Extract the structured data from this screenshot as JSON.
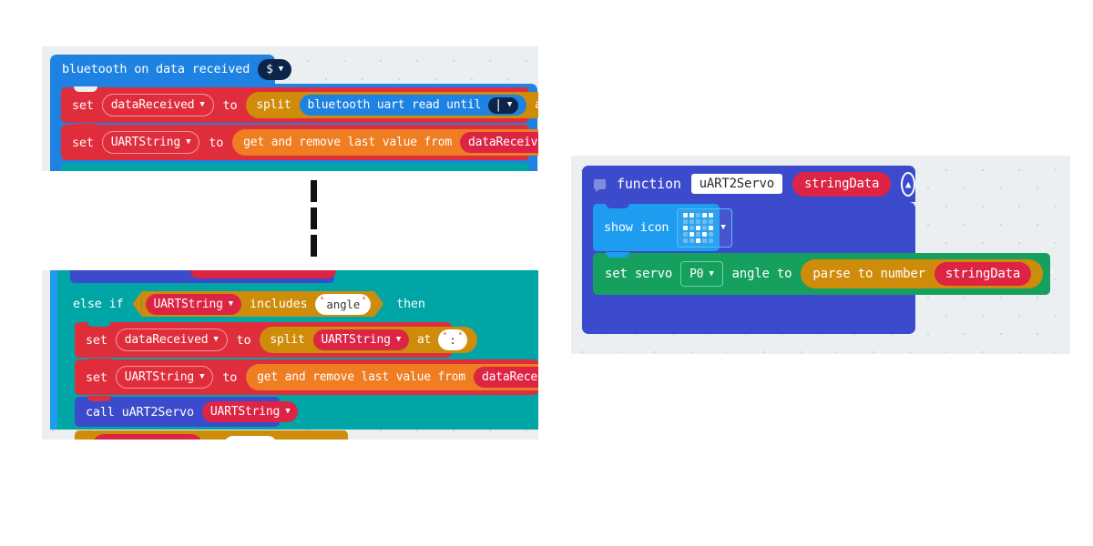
{
  "editor": {
    "name": "makecode-blocks-editor",
    "accent_blue": "#1d82e2",
    "accent_red": "#e02d3c",
    "accent_gold": "#cf8c0b",
    "accent_teal": "#00a5a5",
    "accent_green": "#16a05e",
    "accent_purple": "#3c4bcc",
    "accent_orange": "#ef7d22",
    "canvas_bg": "#eceff1"
  },
  "bluetooth_event": {
    "hat_label": "bluetooth on data received",
    "hat_dropdown_value": "$",
    "rows": [
      {
        "set_label": "set",
        "variable": "dataReceived",
        "to_label": "to",
        "operator": "split",
        "source_block": "bluetooth uart read until",
        "source_dropdown": "|",
        "at_label": "at",
        "at_value": "$"
      },
      {
        "set_label": "set",
        "variable": "UARTString",
        "to_label": "to",
        "operator": "get and remove last value from",
        "argument": "dataReceived"
      }
    ]
  },
  "else_if_group": {
    "else_if_label": "else if",
    "condition_variable": "UARTString",
    "includes_label": "includes",
    "includes_value": "angle",
    "then_label": "then",
    "rows": [
      {
        "set_label": "set",
        "variable": "dataReceived",
        "to_label": "to",
        "operator": "split",
        "argument": "UARTString",
        "at_label": "at",
        "at_value": ":"
      },
      {
        "set_label": "set",
        "variable": "UARTString",
        "to_label": "to",
        "operator": "get and remove last value from",
        "argument": "dataReceived"
      },
      {
        "call_label": "call uART2Servo",
        "argument": "UARTString"
      }
    ]
  },
  "function_def": {
    "function_label": "function",
    "function_name": "uART2Servo",
    "parameter": "stringData",
    "collapse_icon": "chevron-up-circle-icon",
    "comment_icon": "comment-icon",
    "show_icon_row": {
      "label": "show icon",
      "icon_name": "led-matrix-icon",
      "pattern": [
        [
          1,
          1,
          0,
          1,
          1
        ],
        [
          0,
          0,
          0,
          0,
          0
        ],
        [
          1,
          0,
          1,
          0,
          1
        ],
        [
          0,
          1,
          0,
          1,
          0
        ],
        [
          0,
          0,
          1,
          0,
          0
        ]
      ]
    },
    "servo_row": {
      "label": "set servo",
      "pin": "P0",
      "angle_label": "angle to",
      "operator": "parse to number",
      "argument": "stringData",
      "unit": "°"
    }
  },
  "connector": {
    "name": "dashed-connector"
  }
}
